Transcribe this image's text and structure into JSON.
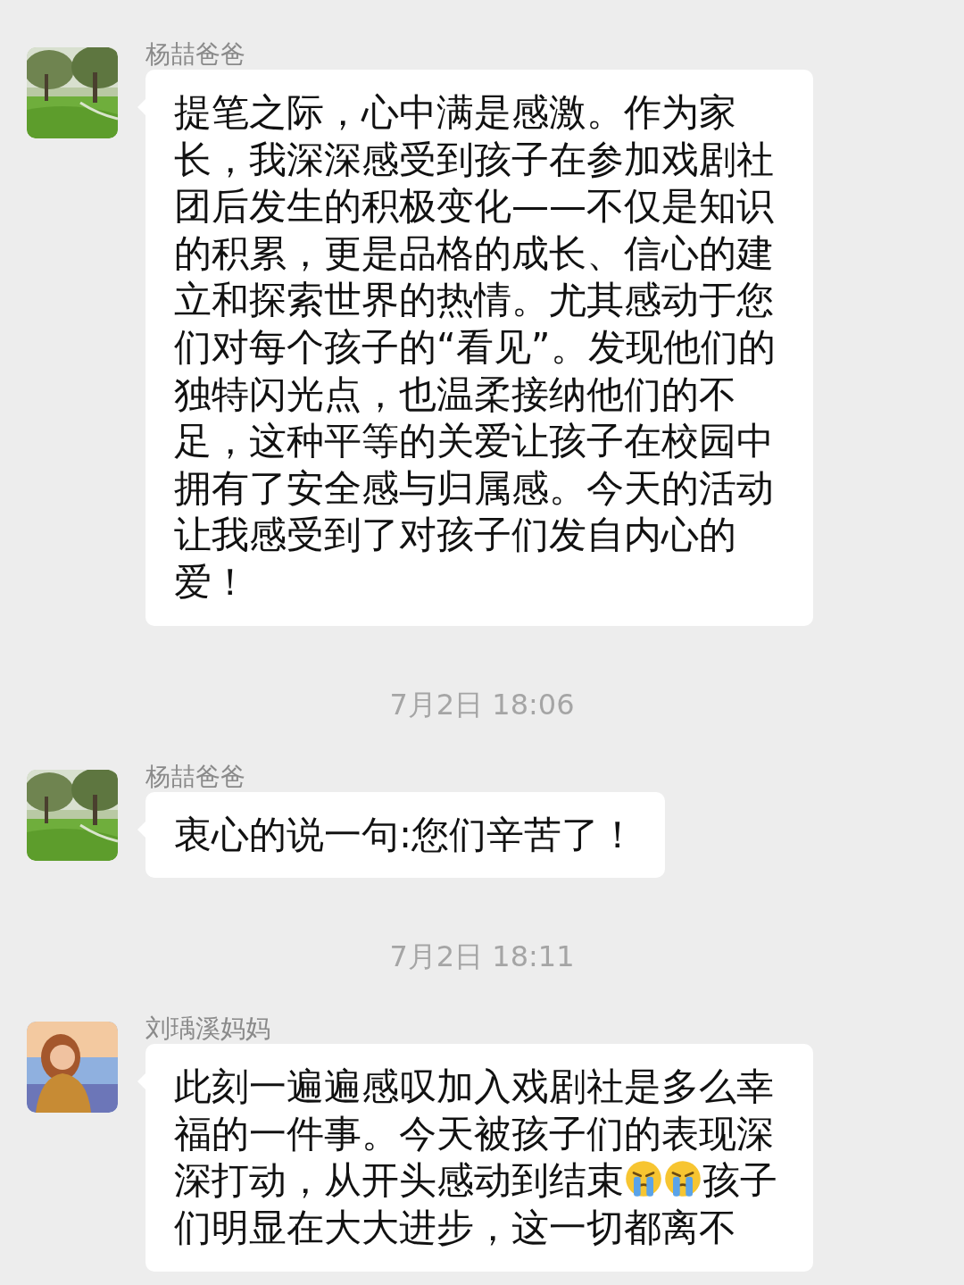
{
  "chat": [
    {
      "kind": "message",
      "name": "杨喆爸爸",
      "avatar": {
        "kind": "landscape"
      },
      "parts": [
        {
          "kind": "text",
          "text": "提笔之际，心中满是感激。作为家长，我深深感受到孩子在参加戏剧社团后发生的积极变化——不仅是知识的积累，更是品格的成长、信心的建立和探索世界的热情。尤其感动于您们对每个孩子的“看见”。发现他们的独特闪光点，也温柔接纳他们的不足，这种平等的关爱让孩子在校园中拥有了安全感与归属感。今天的活动让我感受到了对孩子们发自内心的爱！"
        }
      ]
    },
    {
      "kind": "time",
      "text": "7月2日 18:06"
    },
    {
      "kind": "message",
      "name": "杨喆爸爸",
      "avatar": {
        "kind": "landscape"
      },
      "parts": [
        {
          "kind": "text",
          "text": "衷心的说一句:您们辛苦了！"
        }
      ]
    },
    {
      "kind": "time",
      "text": "7月2日 18:11"
    },
    {
      "kind": "message",
      "name": "刘瑀溪妈妈",
      "avatar": {
        "kind": "figure"
      },
      "parts": [
        {
          "kind": "text",
          "text": "此刻一遍遍感叹加入戏剧社是多么幸福的一件事。今天被孩子们的表现深深打动，从开头感动到结束"
        },
        {
          "kind": "emoji"
        },
        {
          "kind": "emoji"
        },
        {
          "kind": "text",
          "text": "孩子们明显在大大进步，这一切都离不"
        }
      ]
    }
  ]
}
